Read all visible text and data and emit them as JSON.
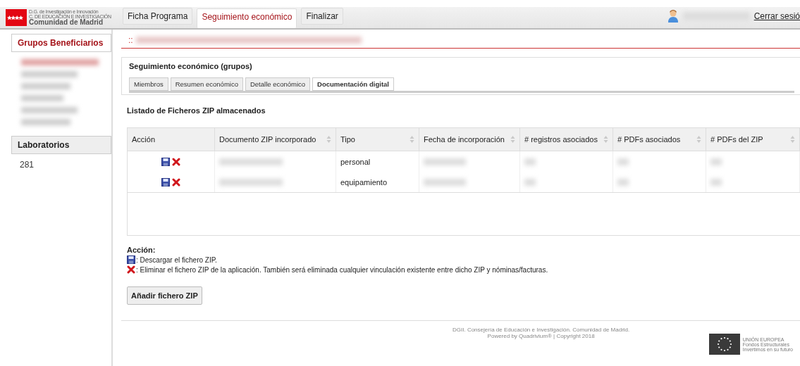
{
  "logo": {
    "line_1": "D.G. de Investigación e Innovación",
    "line_2": "C. DE EDUCACIÓN E INVESTIGACIÓN",
    "line_3": "Comunidad de Madrid"
  },
  "main_tabs": [
    {
      "label": "Ficha Programa",
      "selected": false
    },
    {
      "label": "Seguimiento económico",
      "selected": true
    },
    {
      "label": "Finalizar",
      "selected": false
    }
  ],
  "logout": "Cerrar sesió",
  "sidebar": {
    "sections": [
      {
        "title": "Grupos Beneficiarios",
        "selected": true
      },
      {
        "title": "Laboratorios",
        "selected": false,
        "items": [
          "281"
        ]
      }
    ]
  },
  "breadcrumb_prefix": "::",
  "panel": {
    "title": "Seguimiento económico (grupos)",
    "tabs": [
      {
        "label": "Miembros",
        "selected": false
      },
      {
        "label": "Resumen económico",
        "selected": false
      },
      {
        "label": "Detalle económico",
        "selected": false
      },
      {
        "label": "Documentación digital",
        "selected": true
      }
    ]
  },
  "list_title": "Listado de Ficheros ZIP almacenados",
  "table": {
    "columns": [
      {
        "label": "Acción",
        "sortable": false
      },
      {
        "label": "Documento ZIP incorporado",
        "sortable": true
      },
      {
        "label": "Tipo",
        "sortable": true
      },
      {
        "label": "Fecha de incorporación",
        "sortable": true
      },
      {
        "label": "# registros asociados",
        "sortable": true
      },
      {
        "label": "# PDFs asociados",
        "sortable": true
      },
      {
        "label": "# PDFs del ZIP",
        "sortable": true
      }
    ],
    "rows": [
      {
        "tipo": "personal"
      },
      {
        "tipo": "equipamiento"
      }
    ]
  },
  "legend": {
    "title": "Acción:",
    "download": ": Descargar el fichero ZIP.",
    "delete": ": Eliminar el fichero ZIP de la aplicación. También será eliminada cualquier vinculación existente entre dicho ZIP y nóminas/facturas."
  },
  "add_button": "Añadir fichero ZIP",
  "footer": {
    "line_1": "DGII. Consejería de Educación e Investigación. Comunidad de Madrid.",
    "line_2": "Powered by Quadrivium® | Copyright 2018"
  },
  "eu_logo": {
    "line_1": "UNIÓN EUROPEA",
    "line_2": "Fondos Estructurales",
    "line_3": "Invertimos en su futuro"
  }
}
